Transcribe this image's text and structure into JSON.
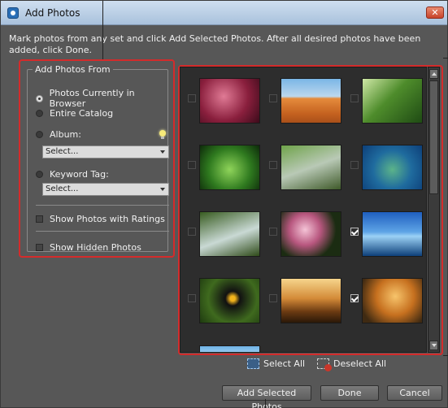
{
  "window": {
    "title": "Add Photos"
  },
  "instructions": "Mark photos from any set and click Add Selected Photos. After all desired photos have been added, click Done.",
  "add_from": {
    "legend": "Add Photos From",
    "options": {
      "browser": "Photos Currently in Browser",
      "catalog": "Entire Catalog",
      "album": "Album:",
      "keyword": "Keyword Tag:"
    },
    "selected_option": "browser",
    "album_select": "Select...",
    "keyword_select": "Select...",
    "show_ratings": "Show Photos with Ratings",
    "show_hidden": "Show Hidden Photos"
  },
  "photos": [
    {
      "subject": "red succulent plant",
      "checked": false
    },
    {
      "subject": "desert dunes with antelope",
      "checked": false
    },
    {
      "subject": "forest path",
      "checked": false
    },
    {
      "subject": "green leafy plant",
      "checked": false
    },
    {
      "subject": "stream through greenery",
      "checked": false
    },
    {
      "subject": "sea turtle with fish",
      "checked": false
    },
    {
      "subject": "waterfall in forest",
      "checked": false
    },
    {
      "subject": "pink flowers",
      "checked": false
    },
    {
      "subject": "ocean pier at dusk",
      "checked": true
    },
    {
      "subject": "toucan on branch",
      "checked": false
    },
    {
      "subject": "tree at sunset",
      "checked": false
    },
    {
      "subject": "autumn tree",
      "checked": true
    }
  ],
  "actions": {
    "select_all": "Select All",
    "deselect_all": "Deselect All",
    "add_selected": "Add Selected Photos",
    "done": "Done",
    "cancel": "Cancel"
  }
}
